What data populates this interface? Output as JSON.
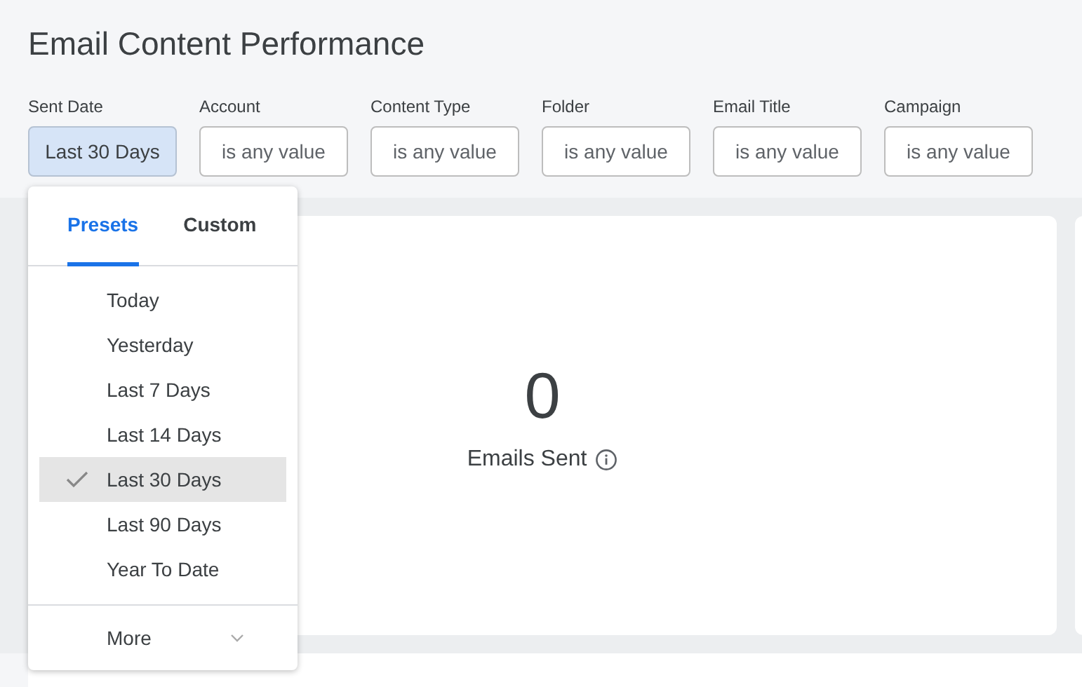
{
  "title": "Email Content Performance",
  "filters": [
    {
      "label": "Sent Date",
      "value": "Last 30 Days",
      "active": true
    },
    {
      "label": "Account",
      "value": "is any value",
      "active": false
    },
    {
      "label": "Content Type",
      "value": "is any value",
      "active": false
    },
    {
      "label": "Folder",
      "value": "is any value",
      "active": false
    },
    {
      "label": "Email Title",
      "value": "is any value",
      "active": false
    },
    {
      "label": "Campaign",
      "value": "is any value",
      "active": false
    }
  ],
  "dropdown": {
    "tabs": [
      {
        "label": "Presets",
        "selected": true
      },
      {
        "label": "Custom",
        "selected": false
      }
    ],
    "items": [
      {
        "label": "Today",
        "selected": false
      },
      {
        "label": "Yesterday",
        "selected": false
      },
      {
        "label": "Last 7 Days",
        "selected": false
      },
      {
        "label": "Last 14 Days",
        "selected": false
      },
      {
        "label": "Last 30 Days",
        "selected": true
      },
      {
        "label": "Last 90 Days",
        "selected": false
      },
      {
        "label": "Year To Date",
        "selected": false
      }
    ],
    "more": "More"
  },
  "metric": {
    "value": "0",
    "label": "Emails Sent"
  }
}
